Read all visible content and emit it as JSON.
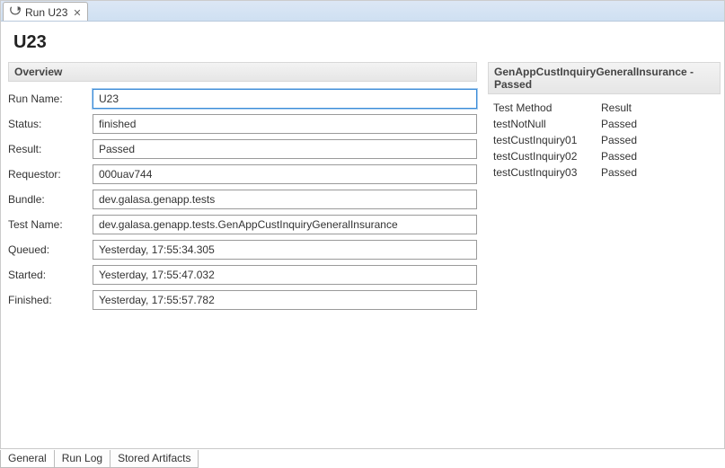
{
  "tab": {
    "title": "Run U23"
  },
  "page": {
    "title": "U23"
  },
  "overview": {
    "header": "Overview",
    "fields": {
      "run_name": {
        "label": "Run Name:",
        "value": "U23"
      },
      "status": {
        "label": "Status:",
        "value": "finished"
      },
      "result": {
        "label": "Result:",
        "value": "Passed"
      },
      "requestor": {
        "label": "Requestor:",
        "value": "000uav744"
      },
      "bundle": {
        "label": "Bundle:",
        "value": "dev.galasa.genapp.tests"
      },
      "test_name": {
        "label": "Test Name:",
        "value": "dev.galasa.genapp.tests.GenAppCustInquiryGeneralInsurance"
      },
      "queued": {
        "label": "Queued:",
        "value": "Yesterday, 17:55:34.305"
      },
      "started": {
        "label": "Started:",
        "value": "Yesterday, 17:55:47.032"
      },
      "finished": {
        "label": "Finished:",
        "value": "Yesterday, 17:55:57.782"
      }
    }
  },
  "results": {
    "header": "GenAppCustInquiryGeneralInsurance - Passed",
    "columns": {
      "method": "Test Method",
      "result": "Result"
    },
    "rows": [
      {
        "method": "testNotNull",
        "result": "Passed"
      },
      {
        "method": "testCustInquiry01",
        "result": "Passed"
      },
      {
        "method": "testCustInquiry02",
        "result": "Passed"
      },
      {
        "method": "testCustInquiry03",
        "result": "Passed"
      }
    ]
  },
  "bottom_tabs": {
    "general": "General",
    "run_log": "Run Log",
    "artifacts": "Stored Artifacts"
  }
}
